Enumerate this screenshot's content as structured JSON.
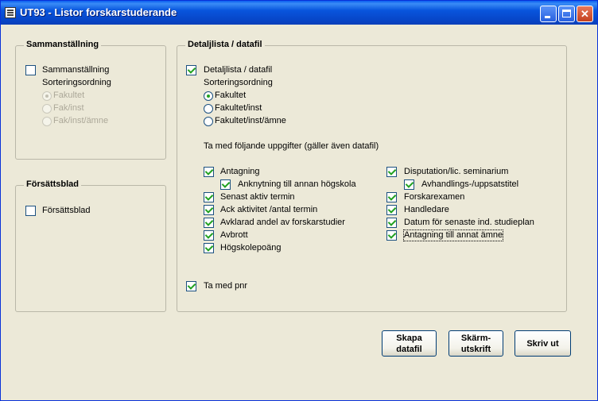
{
  "window": {
    "title": "UT93 - Listor forskarstuderande",
    "min_glyph": "_",
    "max_glyph": "□",
    "close_glyph": "✕",
    "icon": "report-icon"
  },
  "summary_group": {
    "legend": "Sammanställning",
    "checkbox_label": "Sammanställning",
    "checked": false,
    "sort_label": "Sorteringsordning",
    "options": [
      "Fakultet",
      "Fak/inst",
      "Fak/inst/ämne"
    ],
    "selected_index": 0,
    "enabled": false
  },
  "cover_group": {
    "legend": "Försättsblad",
    "checkbox_label": "Försättsblad",
    "checked": false
  },
  "detail_group": {
    "legend": "Detaljlista / datafil",
    "checkbox_label": "Detaljlista / datafil",
    "checked": true,
    "sort_label": "Sorteringsordning",
    "options": [
      "Fakultet",
      "Fakultet/inst",
      "Fakultet/inst/ämne"
    ],
    "selected_index": 0,
    "include_label": "Ta med följande uppgifter (gäller även datafil)",
    "left_items": [
      {
        "label": "Antagning",
        "checked": true
      },
      {
        "label": "Anknytning till annan högskola",
        "checked": true
      },
      {
        "label": "Senast aktiv termin",
        "checked": true
      },
      {
        "label": "Ack aktivitet /antal termin",
        "checked": true
      },
      {
        "label": "Avklarad andel av forskarstudier",
        "checked": true
      },
      {
        "label": "Avbrott",
        "checked": true
      },
      {
        "label": "Högskolepoäng",
        "checked": true
      }
    ],
    "right_items": [
      {
        "label": "Disputation/lic. seminarium",
        "checked": true
      },
      {
        "label": "Avhandlings-/uppsatstitel",
        "checked": true
      },
      {
        "label": "Forskarexamen",
        "checked": true
      },
      {
        "label": "Handledare",
        "checked": true
      },
      {
        "label": "Datum för senaste ind. studieplan",
        "checked": true
      },
      {
        "label": "Antagning till annat ämne",
        "checked": true
      }
    ],
    "pnr_label": "Ta med pnr",
    "pnr_checked": true
  },
  "buttons": {
    "create_file": "Skapa\ndatafil",
    "screen_print": "Skärm-\nutskrift",
    "print": "Skriv ut"
  }
}
